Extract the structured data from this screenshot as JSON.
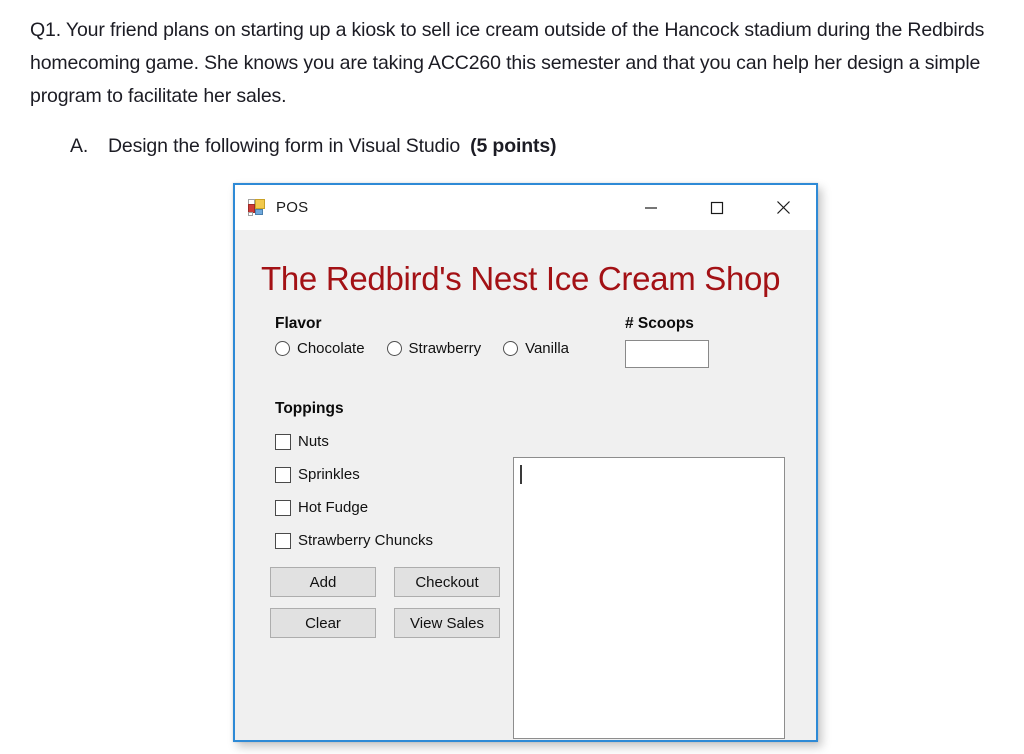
{
  "document": {
    "question_text": "Q1. Your friend plans on starting up a kiosk to sell ice cream outside of the Hancock stadium during the Redbirds homecoming game. She knows you are taking ACC260 this semester and that you can help her design a simple program to facilitate her sales.",
    "sub_marker": "A.",
    "sub_text": "Design the following form in Visual Studio",
    "sub_points": "(5 points)"
  },
  "form": {
    "title": "POS",
    "icon": "visual-studio-form-icon",
    "window_controls": {
      "minimize": "minimize-icon",
      "maximize": "maximize-icon",
      "close": "close-icon"
    },
    "heading": "The Redbird's Nest Ice Cream Shop",
    "heading_color": "#a31115",
    "border_color": "#2e8ad6",
    "client_background": "#f0f0f0",
    "flavor": {
      "label": "Flavor",
      "options": [
        {
          "label": "Chocolate",
          "selected": false
        },
        {
          "label": "Strawberry",
          "selected": false
        },
        {
          "label": "Vanilla",
          "selected": false
        }
      ]
    },
    "scoops": {
      "label": "# Scoops",
      "value": "",
      "placeholder": ""
    },
    "toppings": {
      "label": "Toppings",
      "options": [
        {
          "label": "Nuts",
          "checked": false
        },
        {
          "label": "Sprinkles",
          "checked": false
        },
        {
          "label": "Hot Fudge",
          "checked": false
        },
        {
          "label": "Strawberry Chuncks",
          "checked": false
        }
      ]
    },
    "buttons": [
      {
        "label": "Add"
      },
      {
        "label": "Checkout"
      },
      {
        "label": "Clear"
      },
      {
        "label": "View Sales"
      }
    ],
    "output": {
      "value": "",
      "caret_visible": true
    }
  }
}
